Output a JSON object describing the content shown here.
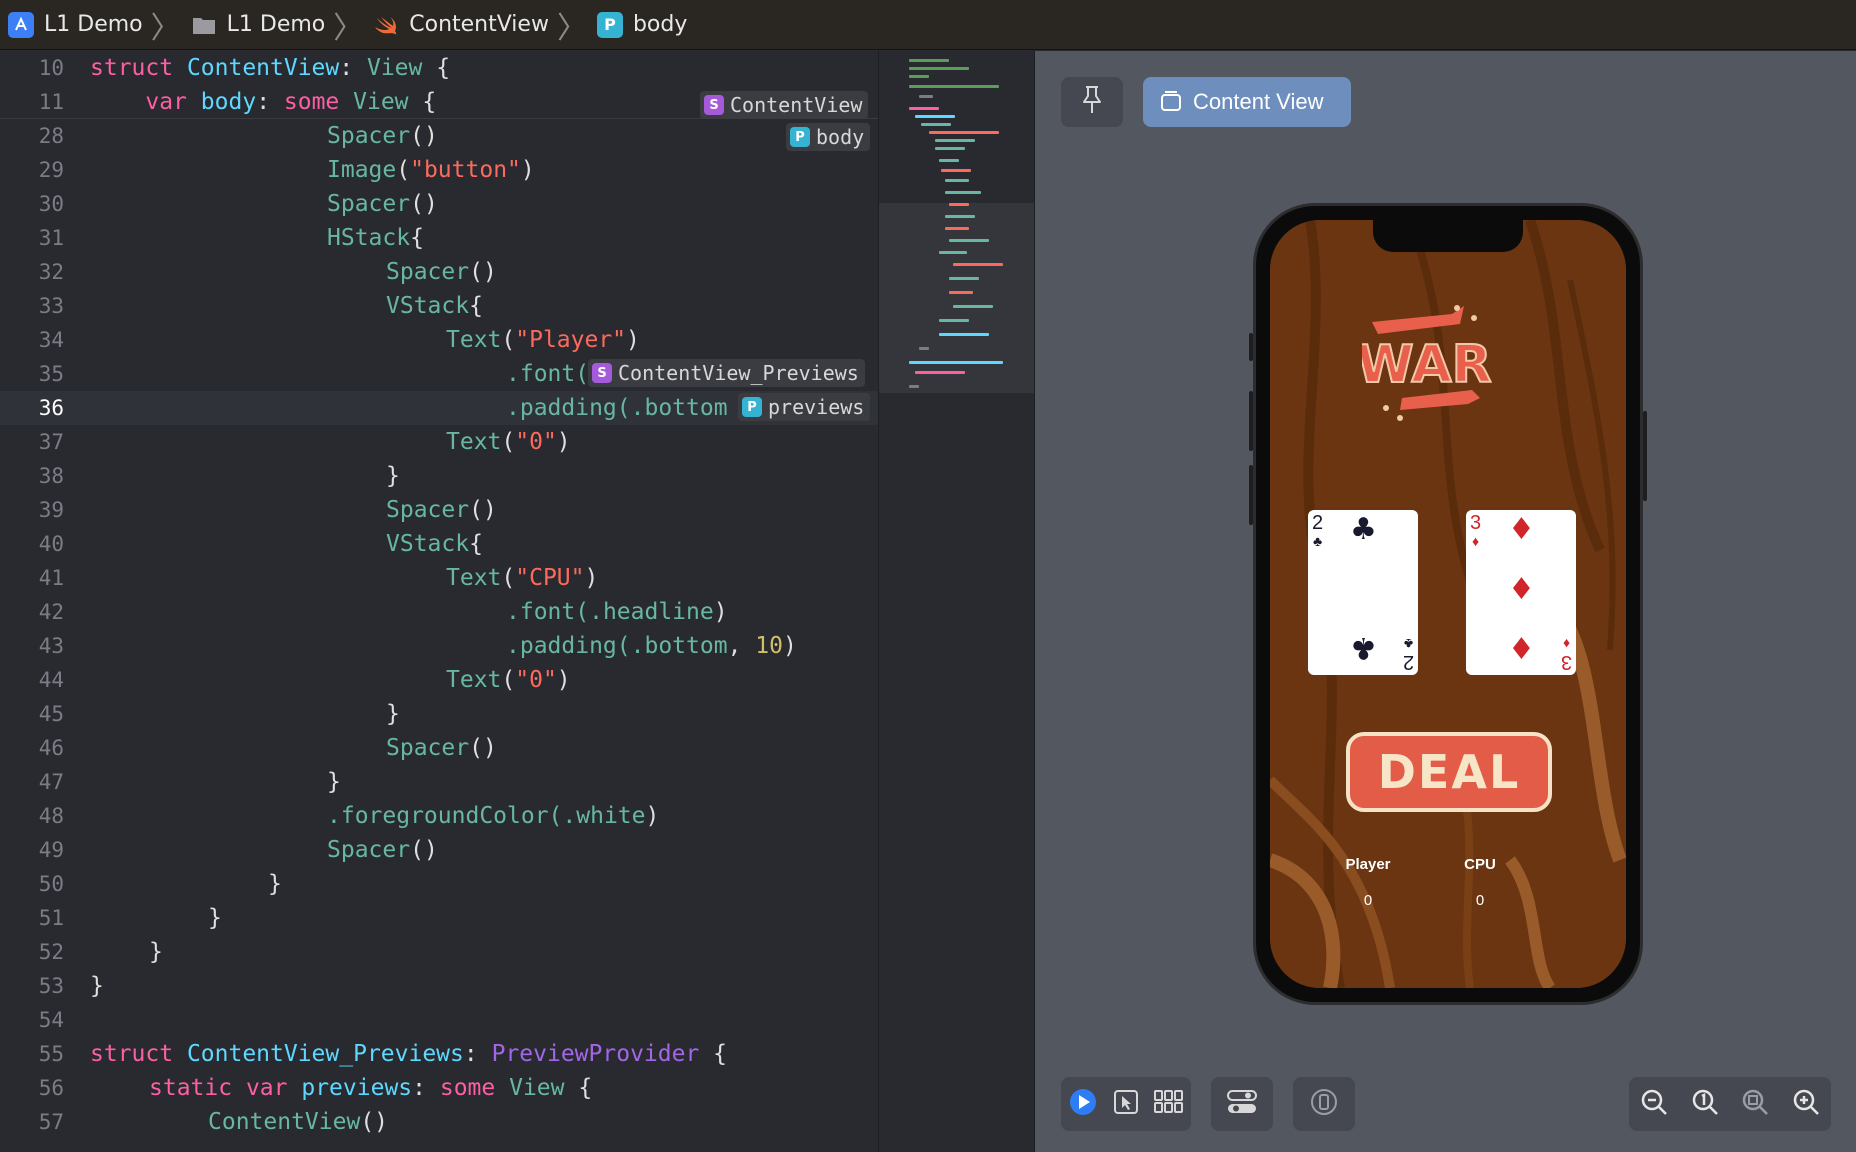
{
  "breadcrumb": [
    {
      "label": "L1 Demo",
      "icon": "app-icon"
    },
    {
      "label": "L1 Demo",
      "icon": "folder-icon"
    },
    {
      "label": "ContentView",
      "icon": "swift-file-icon"
    },
    {
      "label": "body",
      "icon": "property-icon",
      "badge": "P"
    }
  ],
  "editor": {
    "current_line": "36",
    "lines": [
      {
        "num": "10"
      },
      {
        "num": "11"
      },
      {
        "num": "28"
      },
      {
        "num": "29"
      },
      {
        "num": "30"
      },
      {
        "num": "31"
      },
      {
        "num": "32"
      },
      {
        "num": "33"
      },
      {
        "num": "34"
      },
      {
        "num": "35"
      },
      {
        "num": "36"
      },
      {
        "num": "37"
      },
      {
        "num": "38"
      },
      {
        "num": "39"
      },
      {
        "num": "40"
      },
      {
        "num": "41"
      },
      {
        "num": "42"
      },
      {
        "num": "43"
      },
      {
        "num": "44"
      },
      {
        "num": "45"
      },
      {
        "num": "46"
      },
      {
        "num": "47"
      },
      {
        "num": "48"
      },
      {
        "num": "49"
      },
      {
        "num": "50"
      },
      {
        "num": "51"
      },
      {
        "num": "52"
      },
      {
        "num": "53"
      },
      {
        "num": "54"
      },
      {
        "num": "55"
      },
      {
        "num": "56"
      },
      {
        "num": "57"
      }
    ],
    "code": {
      "l10_a": "struct ",
      "l10_b": "ContentView",
      "l10_c": ": ",
      "l10_d": "View",
      "l10_e": " {",
      "l11_a": "    ",
      "l11_b": "var",
      "l11_c": " ",
      "l11_d": "body",
      "l11_e": ": ",
      "l11_f": "some",
      "l11_g": " ",
      "l11_h": "View",
      "l11_i": " {",
      "l28": "Spacer",
      "l29_a": "Image",
      "l29_b": "\"button\"",
      "l30": "Spacer",
      "l31": "HStack",
      "l32": "Spacer",
      "l33": "VStack",
      "l34_a": "Text",
      "l34_b": "\"Player\"",
      "l35": ".font(",
      "l36": ".padding(.bottom",
      "l37_a": "Text",
      "l37_b": "\"0\"",
      "l39": "Spacer",
      "l40": "VStack",
      "l41_a": "Text",
      "l41_b": "\"CPU\"",
      "l42_a": ".font(",
      "l42_b": ".headline",
      "l42_c": ")",
      "l43_a": ".padding(",
      "l43_b": ".bottom",
      "l43_c": ", ",
      "l43_d": "10",
      "l43_e": ")",
      "l44_a": "Text",
      "l44_b": "\"0\"",
      "l46": "Spacer",
      "l48_a": ".foregroundColor(",
      "l48_b": ".white",
      "l48_c": ")",
      "l49": "Spacer",
      "l55_a": "struct ",
      "l55_b": "ContentView_Previews",
      "l55_c": ": ",
      "l55_d": "PreviewProvider",
      "l55_e": " {",
      "l56_a": "static",
      "l56_b": " ",
      "l56_c": "var",
      "l56_d": " ",
      "l56_e": "previews",
      "l56_f": ": ",
      "l56_g": "some",
      "l56_h": " ",
      "l56_i": "View",
      "l56_j": " {",
      "l57_a": "ContentView",
      "l57_b": "()",
      "paren": "()",
      "brace_open": "{",
      "brace_close": "}",
      "close_paren": ")"
    },
    "scope_pills": [
      {
        "badge": "S",
        "label": "ContentView"
      },
      {
        "badge": "P",
        "label": "body"
      },
      {
        "badge": "S",
        "label": "ContentView_Previews"
      },
      {
        "badge": "P",
        "label": "previews"
      }
    ]
  },
  "canvas": {
    "pin_icon": "pin-icon",
    "preview_button_label": "Content View",
    "app": {
      "title_art": "WAR",
      "player_card": {
        "rank": "2",
        "suit": "♣",
        "color": "#1a1a2e"
      },
      "cpu_card": {
        "rank": "3",
        "suit": "♦",
        "color": "#d0262a"
      },
      "deal_label": "DEAL",
      "player_label": "Player",
      "cpu_label": "CPU",
      "player_score": "0",
      "cpu_score": "0"
    },
    "bottom_toolbar": {
      "groups": [
        [
          "live-preview-icon",
          "select-icon",
          "grid-variants-icon"
        ],
        [
          "device-settings-icon"
        ],
        [
          "device-icon"
        ],
        [
          "zoom-out-icon",
          "actual-size-icon",
          "zoom-to-fit-icon",
          "zoom-in-icon"
        ]
      ]
    }
  },
  "colors": {
    "editor_bg": "#292a30",
    "keyword": "#fc5fa3",
    "type_decl": "#5dd8ff",
    "type_ref": "#67b7a4",
    "string": "#fc6a5d",
    "number": "#d0bf69",
    "canvas_bg": "#535760",
    "accent": "#6e8fbe",
    "deal_red": "#e35c48"
  }
}
